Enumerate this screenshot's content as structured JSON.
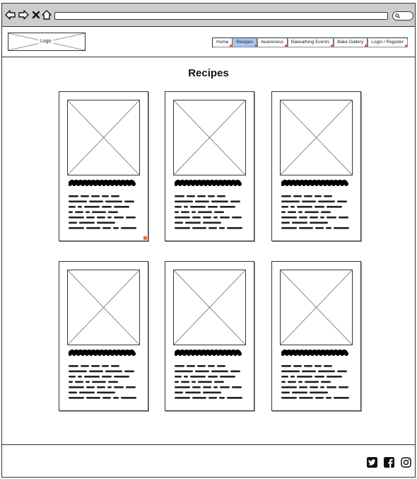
{
  "browser": {
    "icons": [
      "back-arrow-icon",
      "forward-arrow-icon",
      "close-icon",
      "home-icon",
      "search-icon"
    ]
  },
  "header": {
    "logo_label": "Logo",
    "nav": [
      {
        "label": "Home",
        "active": false
      },
      {
        "label": "Recipes",
        "active": true
      },
      {
        "label": "Awareness",
        "active": false
      },
      {
        "label": "Bakeathing Events",
        "active": false
      },
      {
        "label": "Bake Gallery",
        "active": false
      },
      {
        "label": "Login / Register",
        "active": false
      }
    ]
  },
  "main": {
    "title": "Recipes",
    "cards": [
      {
        "name": "recipe-card-1"
      },
      {
        "name": "recipe-card-2"
      },
      {
        "name": "recipe-card-3"
      },
      {
        "name": "recipe-card-4"
      },
      {
        "name": "recipe-card-5"
      },
      {
        "name": "recipe-card-6"
      }
    ]
  },
  "footer": {
    "social_icons": [
      "twitter-icon",
      "facebook-icon",
      "instagram-icon"
    ]
  },
  "colors": {
    "chrome": "#cdcdcd",
    "active_tab": "#a9c6ee",
    "annotation_marker": "#e06a3a",
    "outline": "#333333"
  }
}
